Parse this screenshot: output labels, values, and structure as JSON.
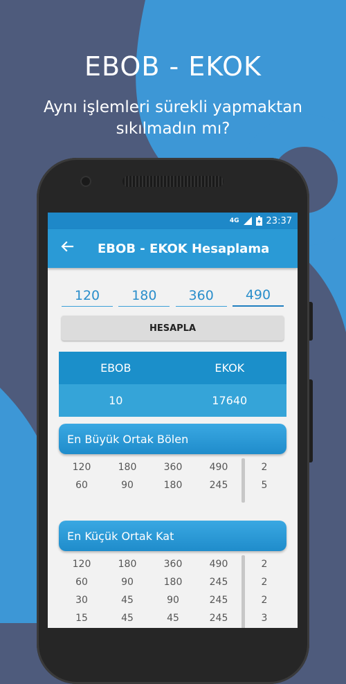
{
  "promo": {
    "title": "EBOB - EKOK",
    "subtitle_line1": "Aynı işlemleri sürekli yapmaktan",
    "subtitle_line2": "sıkılmadın mı?"
  },
  "status_bar": {
    "network": "4G",
    "time": "23:37"
  },
  "app_bar": {
    "title": "EBOB - EKOK Hesaplama"
  },
  "inputs": [
    "120",
    "180",
    "360",
    "490"
  ],
  "calculate_label": "HESAPLA",
  "result": {
    "headers": [
      "EBOB",
      "EKOK"
    ],
    "values": [
      "10",
      "17640"
    ]
  },
  "ebob_card": {
    "title": "En Büyük Ortak Bölen",
    "rows": [
      {
        "values": [
          "120",
          "180",
          "360",
          "490"
        ],
        "divisor": "2"
      },
      {
        "values": [
          "60",
          "90",
          "180",
          "245"
        ],
        "divisor": "5"
      }
    ]
  },
  "ekok_card": {
    "title": "En Küçük Ortak Kat",
    "rows": [
      {
        "values": [
          "120",
          "180",
          "360",
          "490"
        ],
        "divisor": "2"
      },
      {
        "values": [
          "60",
          "90",
          "180",
          "245"
        ],
        "divisor": "2"
      },
      {
        "values": [
          "30",
          "45",
          "90",
          "245"
        ],
        "divisor": "2"
      },
      {
        "values": [
          "15",
          "45",
          "45",
          "245"
        ],
        "divisor": "3"
      }
    ]
  },
  "colors": {
    "background": "#4e5b7c",
    "swirl": "#3d97d6",
    "app_bar": "#2a9ad6",
    "status_bar": "#1e88c8"
  }
}
